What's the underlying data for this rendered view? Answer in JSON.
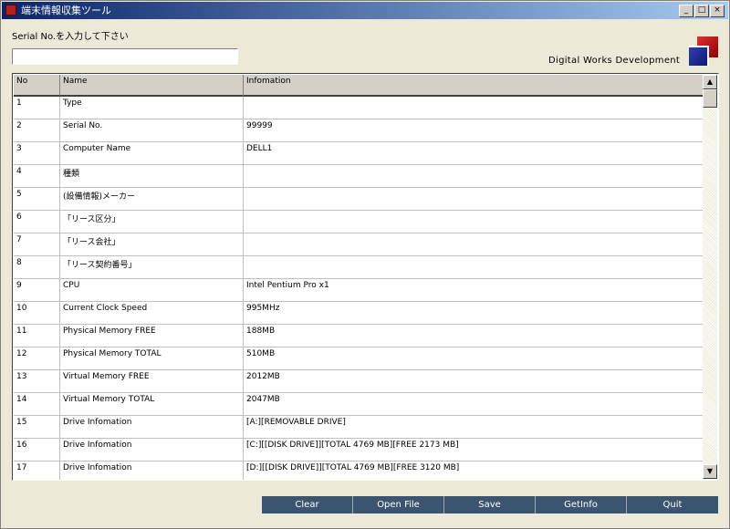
{
  "window": {
    "title": "端末情報収集ツール",
    "min_symbol": "_",
    "max_symbol": "□",
    "close_symbol": "×"
  },
  "serial": {
    "label": "Serial No.を入力して下さい",
    "value": ""
  },
  "brand": "Digital Works Development",
  "grid": {
    "columns": [
      "No",
      "Name",
      "Infomation"
    ],
    "rows": [
      {
        "no": "1",
        "name": "Type",
        "info": ""
      },
      {
        "no": "2",
        "name": "Serial No.",
        "info": "99999"
      },
      {
        "no": "3",
        "name": "Computer Name",
        "info": "DELL1"
      },
      {
        "no": "4",
        "name": "種類",
        "info": ""
      },
      {
        "no": "5",
        "name": "(設備情報)メーカー",
        "info": ""
      },
      {
        "no": "6",
        "name": "「リース区分」",
        "info": ""
      },
      {
        "no": "7",
        "name": "「リース会社」",
        "info": ""
      },
      {
        "no": "8",
        "name": "「リース契約番号」",
        "info": ""
      },
      {
        "no": "9",
        "name": "CPU",
        "info": "Intel Pentium Pro x1"
      },
      {
        "no": "10",
        "name": "Current Clock Speed",
        "info": "995MHz"
      },
      {
        "no": "11",
        "name": "Physical Memory FREE",
        "info": "188MB"
      },
      {
        "no": "12",
        "name": "Physical Memory TOTAL",
        "info": "510MB"
      },
      {
        "no": "13",
        "name": "Virtual Memory FREE",
        "info": "2012MB"
      },
      {
        "no": "14",
        "name": "Virtual Memory TOTAL",
        "info": "2047MB"
      },
      {
        "no": "15",
        "name": "Drive Infomation",
        "info": "[A:][REMOVABLE DRIVE]"
      },
      {
        "no": "16",
        "name": "Drive Infomation",
        "info": "[C:][[DISK DRIVE]][TOTAL 4769 MB][FREE 2173 MB]"
      },
      {
        "no": "17",
        "name": "Drive Infomation",
        "info": "[D:][[DISK DRIVE]][TOTAL 4769 MB][FREE 3120 MB]"
      }
    ]
  },
  "scroll": {
    "up": "▲",
    "down": "▼"
  },
  "actions": [
    "Clear",
    "Open File",
    "Save",
    "GetInfo",
    "Quit"
  ],
  "icons": {
    "app": "app-icon",
    "logo": "dwd-logo"
  }
}
